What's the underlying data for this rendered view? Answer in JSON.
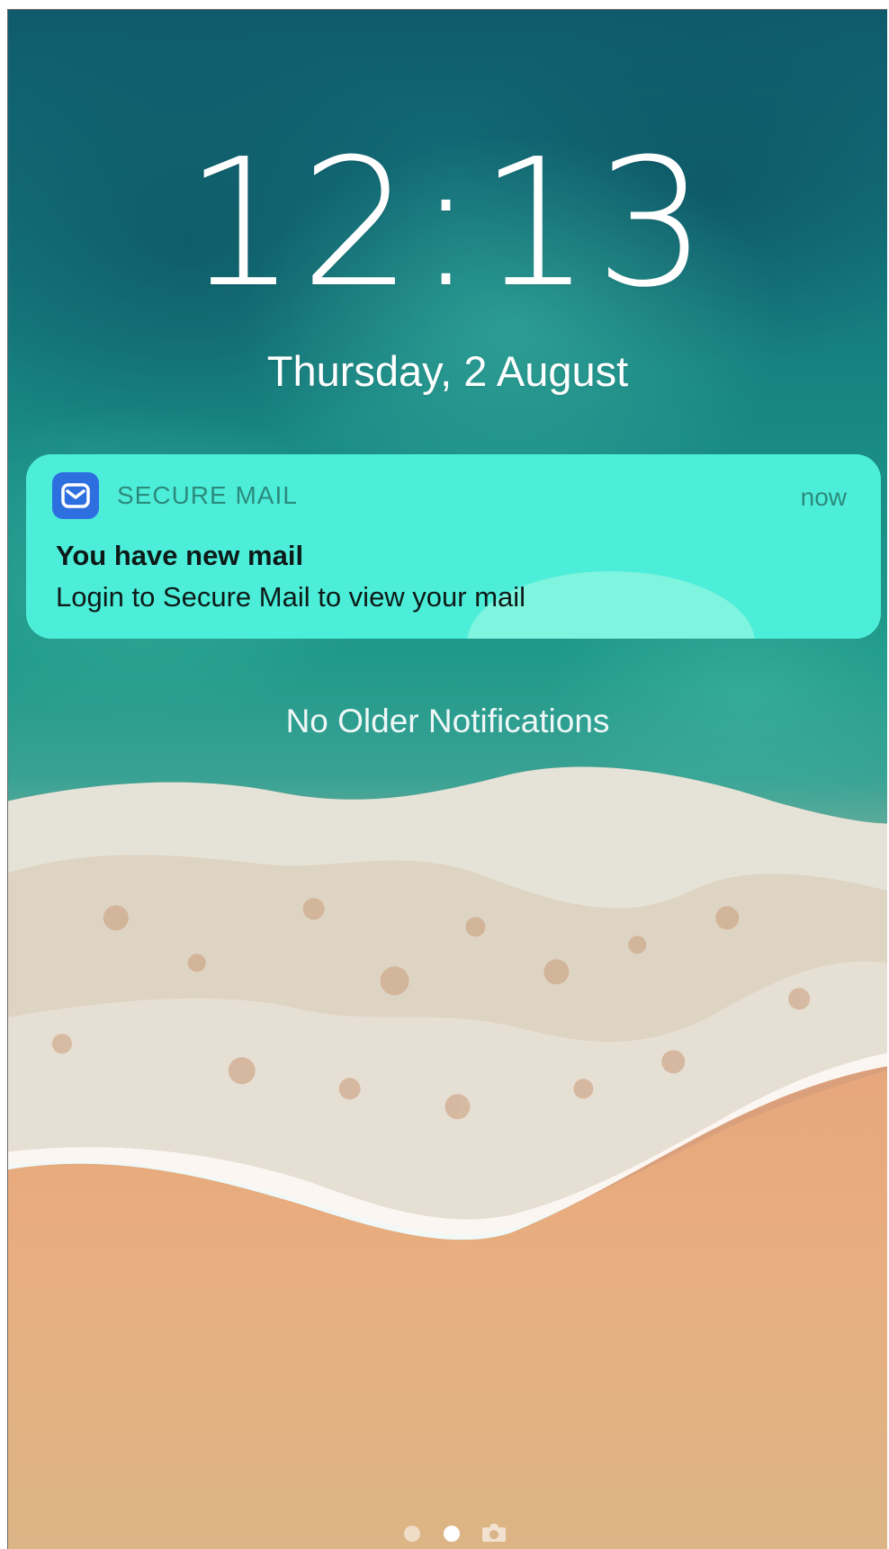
{
  "lock_screen": {
    "time": "12:13",
    "date": "Thursday, 2 August"
  },
  "notification": {
    "app_icon": "envelope-icon",
    "app_name": "SECURE MAIL",
    "time": "now",
    "title": "You have new mail",
    "body": "Login to Secure Mail to view your mail",
    "background_color": "#4deed9",
    "icon_color": "#2e6fe0"
  },
  "footer_text": "No Older Notifications",
  "page_indicator": {
    "page_count": 2,
    "active_page": 2,
    "camera_icon": "camera-icon"
  }
}
